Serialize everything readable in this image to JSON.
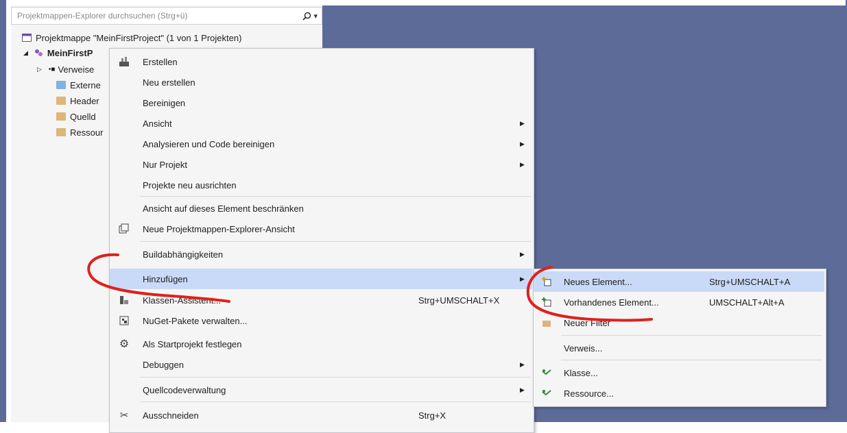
{
  "search": {
    "placeholder": "Projektmappen-Explorer durchsuchen (Strg+ü)",
    "icon": "search-icon"
  },
  "tree": {
    "solution_label": "Projektmappe \"MeinFirstProject\" (1 von 1 Projekten)",
    "project_label": "MeinFirstP",
    "children": [
      "Verweise",
      "Externe",
      "Header",
      "Quelld",
      "Ressour"
    ]
  },
  "menu": {
    "items": [
      {
        "label": "Erstellen",
        "icon": "build-icon"
      },
      {
        "label": "Neu erstellen"
      },
      {
        "label": "Bereinigen"
      },
      {
        "label": "Ansicht",
        "submenu": true
      },
      {
        "label": "Analysieren und Code bereinigen",
        "submenu": true
      },
      {
        "label": "Nur Projekt",
        "submenu": true
      },
      {
        "label": "Projekte neu ausrichten"
      },
      {
        "label": "Ansicht auf dieses Element beschränken"
      },
      {
        "label": "Neue Projektmappen-Explorer-Ansicht",
        "icon": "new-view-icon"
      },
      {
        "label": "Buildabhängigkeiten",
        "submenu": true
      },
      {
        "label": "Hinzufügen",
        "submenu": true,
        "highlighted": true
      },
      {
        "label": "Klassen-Assistent...",
        "shortcut": "Strg+UMSCHALT+X",
        "icon": "class-wizard-icon"
      },
      {
        "label": "NuGet-Pakete verwalten...",
        "icon": "nuget-icon"
      },
      {
        "label": "Als Startprojekt festlegen",
        "icon": "gear-icon"
      },
      {
        "label": "Debuggen",
        "submenu": true
      },
      {
        "label": "Quellcodeverwaltung",
        "submenu": true
      },
      {
        "label": "Ausschneiden",
        "shortcut": "Strg+X",
        "icon": "cut-icon"
      }
    ]
  },
  "submenu": {
    "items": [
      {
        "label": "Neues Element...",
        "shortcut": "Strg+UMSCHALT+A",
        "highlighted": true,
        "icon": "new-item-icon"
      },
      {
        "label": "Vorhandenes Element...",
        "shortcut": "UMSCHALT+Alt+A",
        "icon": "existing-item-icon"
      },
      {
        "label": "Neuer Filter",
        "icon": "new-filter-icon"
      },
      {
        "label": "Verweis..."
      },
      {
        "label": "Klasse...",
        "icon": "class-icon"
      },
      {
        "label": "Ressource...",
        "icon": "resource-icon"
      }
    ]
  },
  "colors": {
    "background": "#5d6b99",
    "menu_bg": "#f5f5f5",
    "highlight": "#c9daf8",
    "annotation": "#e0201c"
  }
}
